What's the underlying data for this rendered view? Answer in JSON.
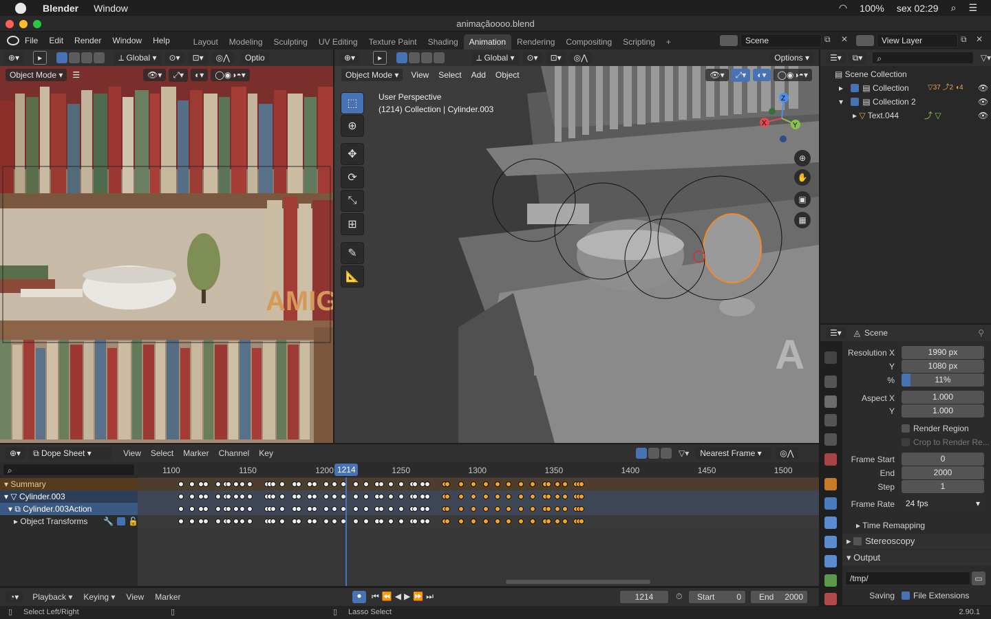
{
  "mac": {
    "app": "Blender",
    "menu_window": "Window",
    "battery": "100%",
    "clock": "sex 02:29"
  },
  "window_title": "animaçãoooo.blend",
  "menu": [
    "File",
    "Edit",
    "Render",
    "Window",
    "Help"
  ],
  "workspaces": [
    "Layout",
    "Modeling",
    "Sculpting",
    "UV Editing",
    "Texture Paint",
    "Shading",
    "Animation",
    "Rendering",
    "Compositing",
    "Scripting"
  ],
  "active_workspace": "Animation",
  "scene_field": "Scene",
  "view_layer_field": "View Layer",
  "left_viewport": {
    "orientation": "Global",
    "options_label": "Optio",
    "mode": "Object Mode"
  },
  "main_viewport": {
    "orientation": "Global",
    "options_label": "Options",
    "mode": "Object Mode",
    "menus": [
      "View",
      "Select",
      "Add",
      "Object"
    ],
    "overlay_line1": "User Perspective",
    "overlay_line2": "(1214) Collection | Cylinder.003",
    "gizmo_axes": {
      "x": "X",
      "y": "Y",
      "z": "Z"
    }
  },
  "outliner": {
    "root": "Scene Collection",
    "items": [
      {
        "label": "Collection",
        "badges": [
          "37",
          "2",
          "4"
        ]
      },
      {
        "label": "Collection 2"
      },
      {
        "label": "Text.044"
      }
    ]
  },
  "properties": {
    "header": "Scene",
    "resolution_x_label": "Resolution X",
    "resolution_x": "1990 px",
    "resolution_y_label": "Y",
    "resolution_y": "1080 px",
    "percent_label": "%",
    "percent": "11%",
    "percent_fill": 0.11,
    "aspect_x_label": "Aspect X",
    "aspect_x": "1.000",
    "aspect_y_label": "Y",
    "aspect_y": "1.000",
    "render_region": "Render Region",
    "crop_label": "Crop to Render Re...",
    "frame_start_label": "Frame Start",
    "frame_start": "0",
    "end_label": "End",
    "end": "2000",
    "step_label": "Step",
    "step": "1",
    "frame_rate_label": "Frame Rate",
    "frame_rate": "24 fps",
    "time_remapping": "Time Remapping",
    "stereoscopy": "Stereoscopy",
    "output": "Output",
    "output_path": "/tmp/",
    "saving_label": "Saving",
    "file_extensions": "File Extensions"
  },
  "dopesheet": {
    "mode": "Dope Sheet",
    "menus": [
      "View",
      "Select",
      "Marker",
      "Channel",
      "Key"
    ],
    "snap": "Nearest Frame",
    "ticks": [
      "1100",
      "1150",
      "1200",
      "1250",
      "1300",
      "1350",
      "1400",
      "1450",
      "1500"
    ],
    "current_frame": "1214",
    "channels": [
      "Summary",
      "Cylinder.003",
      "Cylinder.003Action",
      "Object Transforms"
    ],
    "keyframes": [
      1106,
      1113,
      1119,
      1122,
      1130,
      1135,
      1137,
      1142,
      1146,
      1151,
      1162,
      1164,
      1166,
      1172,
      1180,
      1183,
      1190,
      1193,
      1201,
      1206,
      1212,
      1220,
      1227,
      1234,
      1237,
      1243,
      1250,
      1257,
      1259,
      1264,
      1267
    ],
    "selected_keyframes": [
      1278,
      1280,
      1289,
      1297,
      1305,
      1313,
      1320,
      1328,
      1336,
      1344,
      1346,
      1352,
      1357,
      1364,
      1366,
      1368
    ]
  },
  "timeline": {
    "menus": [
      "Playback",
      "Keying",
      "View",
      "Marker"
    ],
    "frame": "1214",
    "start_label": "Start",
    "start": "0",
    "end_label": "End",
    "end": "2000"
  },
  "status": {
    "left": "Select Left/Right",
    "mid": "Lasso Select",
    "version": "2.90.1"
  }
}
